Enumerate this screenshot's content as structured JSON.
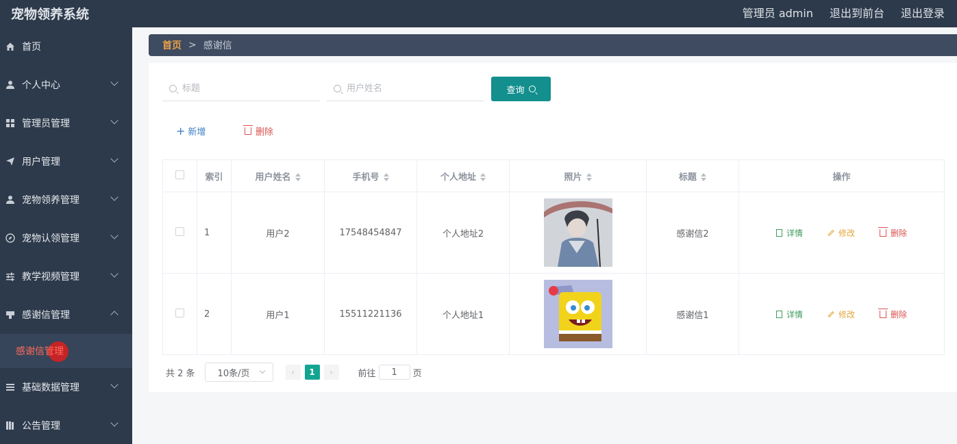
{
  "header": {
    "title": "宠物领养系统",
    "user": "管理员 admin",
    "to_front": "退出到前台",
    "logout": "退出登录"
  },
  "sidebar": {
    "items": [
      {
        "label": "首页",
        "icon": "home-icon"
      },
      {
        "label": "个人中心",
        "icon": "user-icon"
      },
      {
        "label": "管理员管理",
        "icon": "grid-icon"
      },
      {
        "label": "用户管理",
        "icon": "send-icon"
      },
      {
        "label": "宠物领养管理",
        "icon": "user-icon"
      },
      {
        "label": "宠物认领管理",
        "icon": "compass-icon"
      },
      {
        "label": "教学视频管理",
        "icon": "sliders-icon"
      },
      {
        "label": "感谢信管理",
        "icon": "board-icon"
      },
      {
        "label": "基础数据管理",
        "icon": "list-icon"
      },
      {
        "label": "公告管理",
        "icon": "book-icon"
      }
    ],
    "active_sub": "感谢信管理"
  },
  "breadcrumb": {
    "home": "首页",
    "sep": ">",
    "current": "感谢信"
  },
  "search": {
    "title_placeholder": "标题",
    "username_placeholder": "用户姓名",
    "query_label": "查询"
  },
  "actions": {
    "add": "新增",
    "delete": "删除"
  },
  "table": {
    "headers": [
      "索引",
      "用户姓名",
      "手机号",
      "个人地址",
      "照片",
      "标题",
      "操作"
    ],
    "rows": [
      {
        "index": "1",
        "name": "用户2",
        "phone": "17548454847",
        "address": "个人地址2",
        "title": "感谢信2"
      },
      {
        "index": "2",
        "name": "用户1",
        "phone": "15511221136",
        "address": "个人地址1",
        "title": "感谢信1"
      }
    ],
    "ops": {
      "detail": "详情",
      "edit": "修改",
      "delete": "删除"
    }
  },
  "pager": {
    "total": "共 2 条",
    "page_size": "10条/页",
    "current": "1",
    "goto_prefix": "前往",
    "goto_value": "1",
    "goto_suffix": "页"
  },
  "colors": {
    "header_bg": "#2d3a4b",
    "accent": "#138f8e",
    "active_sub": "#ff6a5c"
  }
}
